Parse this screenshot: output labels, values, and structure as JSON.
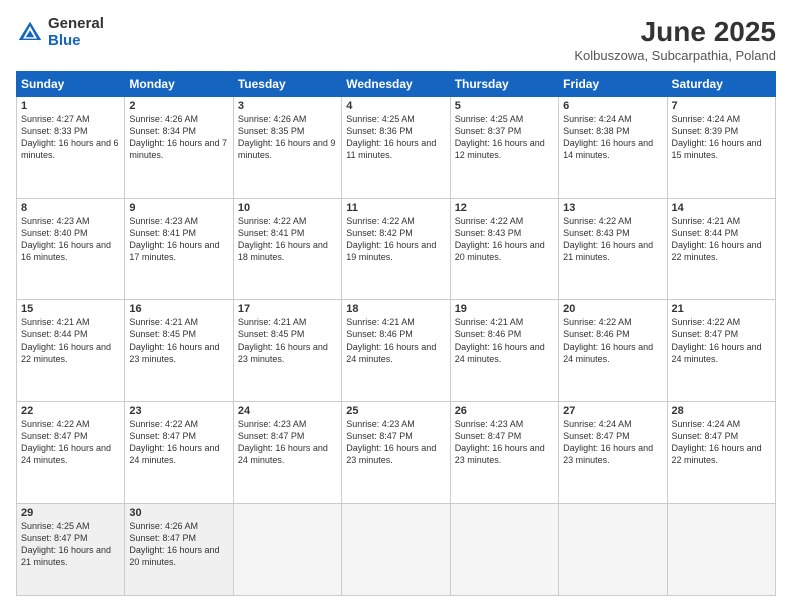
{
  "header": {
    "logo_general": "General",
    "logo_blue": "Blue",
    "month_title": "June 2025",
    "location": "Kolbuszowa, Subcarpathia, Poland"
  },
  "weekdays": [
    "Sunday",
    "Monday",
    "Tuesday",
    "Wednesday",
    "Thursday",
    "Friday",
    "Saturday"
  ],
  "weeks": [
    [
      {
        "day": "1",
        "sunrise": "Sunrise: 4:27 AM",
        "sunset": "Sunset: 8:33 PM",
        "daylight": "Daylight: 16 hours and 6 minutes."
      },
      {
        "day": "2",
        "sunrise": "Sunrise: 4:26 AM",
        "sunset": "Sunset: 8:34 PM",
        "daylight": "Daylight: 16 hours and 7 minutes."
      },
      {
        "day": "3",
        "sunrise": "Sunrise: 4:26 AM",
        "sunset": "Sunset: 8:35 PM",
        "daylight": "Daylight: 16 hours and 9 minutes."
      },
      {
        "day": "4",
        "sunrise": "Sunrise: 4:25 AM",
        "sunset": "Sunset: 8:36 PM",
        "daylight": "Daylight: 16 hours and 11 minutes."
      },
      {
        "day": "5",
        "sunrise": "Sunrise: 4:25 AM",
        "sunset": "Sunset: 8:37 PM",
        "daylight": "Daylight: 16 hours and 12 minutes."
      },
      {
        "day": "6",
        "sunrise": "Sunrise: 4:24 AM",
        "sunset": "Sunset: 8:38 PM",
        "daylight": "Daylight: 16 hours and 14 minutes."
      },
      {
        "day": "7",
        "sunrise": "Sunrise: 4:24 AM",
        "sunset": "Sunset: 8:39 PM",
        "daylight": "Daylight: 16 hours and 15 minutes."
      }
    ],
    [
      {
        "day": "8",
        "sunrise": "Sunrise: 4:23 AM",
        "sunset": "Sunset: 8:40 PM",
        "daylight": "Daylight: 16 hours and 16 minutes."
      },
      {
        "day": "9",
        "sunrise": "Sunrise: 4:23 AM",
        "sunset": "Sunset: 8:41 PM",
        "daylight": "Daylight: 16 hours and 17 minutes."
      },
      {
        "day": "10",
        "sunrise": "Sunrise: 4:22 AM",
        "sunset": "Sunset: 8:41 PM",
        "daylight": "Daylight: 16 hours and 18 minutes."
      },
      {
        "day": "11",
        "sunrise": "Sunrise: 4:22 AM",
        "sunset": "Sunset: 8:42 PM",
        "daylight": "Daylight: 16 hours and 19 minutes."
      },
      {
        "day": "12",
        "sunrise": "Sunrise: 4:22 AM",
        "sunset": "Sunset: 8:43 PM",
        "daylight": "Daylight: 16 hours and 20 minutes."
      },
      {
        "day": "13",
        "sunrise": "Sunrise: 4:22 AM",
        "sunset": "Sunset: 8:43 PM",
        "daylight": "Daylight: 16 hours and 21 minutes."
      },
      {
        "day": "14",
        "sunrise": "Sunrise: 4:21 AM",
        "sunset": "Sunset: 8:44 PM",
        "daylight": "Daylight: 16 hours and 22 minutes."
      }
    ],
    [
      {
        "day": "15",
        "sunrise": "Sunrise: 4:21 AM",
        "sunset": "Sunset: 8:44 PM",
        "daylight": "Daylight: 16 hours and 22 minutes."
      },
      {
        "day": "16",
        "sunrise": "Sunrise: 4:21 AM",
        "sunset": "Sunset: 8:45 PM",
        "daylight": "Daylight: 16 hours and 23 minutes."
      },
      {
        "day": "17",
        "sunrise": "Sunrise: 4:21 AM",
        "sunset": "Sunset: 8:45 PM",
        "daylight": "Daylight: 16 hours and 23 minutes."
      },
      {
        "day": "18",
        "sunrise": "Sunrise: 4:21 AM",
        "sunset": "Sunset: 8:46 PM",
        "daylight": "Daylight: 16 hours and 24 minutes."
      },
      {
        "day": "19",
        "sunrise": "Sunrise: 4:21 AM",
        "sunset": "Sunset: 8:46 PM",
        "daylight": "Daylight: 16 hours and 24 minutes."
      },
      {
        "day": "20",
        "sunrise": "Sunrise: 4:22 AM",
        "sunset": "Sunset: 8:46 PM",
        "daylight": "Daylight: 16 hours and 24 minutes."
      },
      {
        "day": "21",
        "sunrise": "Sunrise: 4:22 AM",
        "sunset": "Sunset: 8:47 PM",
        "daylight": "Daylight: 16 hours and 24 minutes."
      }
    ],
    [
      {
        "day": "22",
        "sunrise": "Sunrise: 4:22 AM",
        "sunset": "Sunset: 8:47 PM",
        "daylight": "Daylight: 16 hours and 24 minutes."
      },
      {
        "day": "23",
        "sunrise": "Sunrise: 4:22 AM",
        "sunset": "Sunset: 8:47 PM",
        "daylight": "Daylight: 16 hours and 24 minutes."
      },
      {
        "day": "24",
        "sunrise": "Sunrise: 4:23 AM",
        "sunset": "Sunset: 8:47 PM",
        "daylight": "Daylight: 16 hours and 24 minutes."
      },
      {
        "day": "25",
        "sunrise": "Sunrise: 4:23 AM",
        "sunset": "Sunset: 8:47 PM",
        "daylight": "Daylight: 16 hours and 23 minutes."
      },
      {
        "day": "26",
        "sunrise": "Sunrise: 4:23 AM",
        "sunset": "Sunset: 8:47 PM",
        "daylight": "Daylight: 16 hours and 23 minutes."
      },
      {
        "day": "27",
        "sunrise": "Sunrise: 4:24 AM",
        "sunset": "Sunset: 8:47 PM",
        "daylight": "Daylight: 16 hours and 23 minutes."
      },
      {
        "day": "28",
        "sunrise": "Sunrise: 4:24 AM",
        "sunset": "Sunset: 8:47 PM",
        "daylight": "Daylight: 16 hours and 22 minutes."
      }
    ],
    [
      {
        "day": "29",
        "sunrise": "Sunrise: 4:25 AM",
        "sunset": "Sunset: 8:47 PM",
        "daylight": "Daylight: 16 hours and 21 minutes."
      },
      {
        "day": "30",
        "sunrise": "Sunrise: 4:26 AM",
        "sunset": "Sunset: 8:47 PM",
        "daylight": "Daylight: 16 hours and 20 minutes."
      },
      null,
      null,
      null,
      null,
      null
    ]
  ]
}
